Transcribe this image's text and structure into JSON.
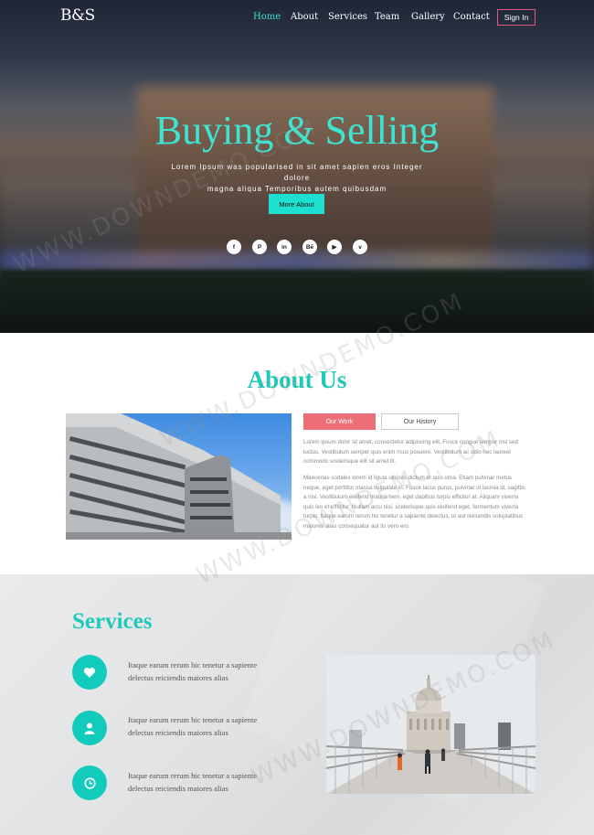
{
  "nav": {
    "logo": "B&S",
    "links": [
      "Home",
      "About",
      "Services",
      "Team",
      "Gallery",
      "Contact"
    ],
    "active": "Home",
    "signin_label": "Sign In"
  },
  "hero": {
    "title": "Buying & Selling",
    "subtitle_line1": "Lorem Ipsum was popularised in sit amet sapien eros Integer dolore",
    "subtitle_line2": "magna aliqua Temporibus autem quibusdam",
    "cta_label": "More About",
    "social_icons": [
      "facebook-icon",
      "pinterest-icon",
      "linkedin-icon",
      "behance-icon",
      "youtube-icon",
      "vimeo-icon"
    ],
    "social_glyphs": [
      "f",
      "P",
      "in",
      "Bē",
      "▶",
      "v"
    ]
  },
  "about": {
    "title": "About Us",
    "tabs": [
      "Our Work",
      "Our History"
    ],
    "para1": "Lorem ipsum dolor sit amet, consectetur adipiscing elit. Fusce congue tempor nisi sed luctus. Vestibulum semper quis enim risus posuere. Vestibulum ac odio nec laoreet commodo scelerisque elit sit amet lit.",
    "para2": "Maecenas sodales lorem id ligula ultrices dictum et quis urna. Etiam pulvinar metus neque, eget porttitor massa vulputate in. Fusce lacus purus, pulvinar ut lacinia id, sagittis a nisi. Vestibulum eleifend mauris sem, eget dapibus turpis efficitur at. Aliquam viverra quis leo et efficitur. Nullam arcu nisi, scelerisque quis eleifend eget, fermentum viverra turpis. Itaque earum rerum hic tenetur a sapiente delectus, ut aut reiciendis voluptatibus maiores alias consequatur aut its vero ero."
  },
  "services": {
    "title": "Services",
    "items": [
      {
        "icon": "heart-icon",
        "line1": "Itaque earum rerum hic tenetur a sapiente",
        "line2": "delectus reiciendis maiores alias"
      },
      {
        "icon": "user-icon",
        "line1": "Itaque earum rerum hic tenetur a sapiente",
        "line2": "delectus reiciendis maiores alias"
      },
      {
        "icon": "clock-icon",
        "line1": "Itaque earum rerum hic tenetur a sapiente",
        "line2": "delectus reiciendis maiores alias"
      }
    ]
  },
  "watermark": "WWW.DOWNDEMO.COM",
  "colors": {
    "accent": "#1fc8b8",
    "accent_bright": "#3fe3d2",
    "tab_active": "#ec6e76",
    "signin_border": "#e05b84"
  }
}
